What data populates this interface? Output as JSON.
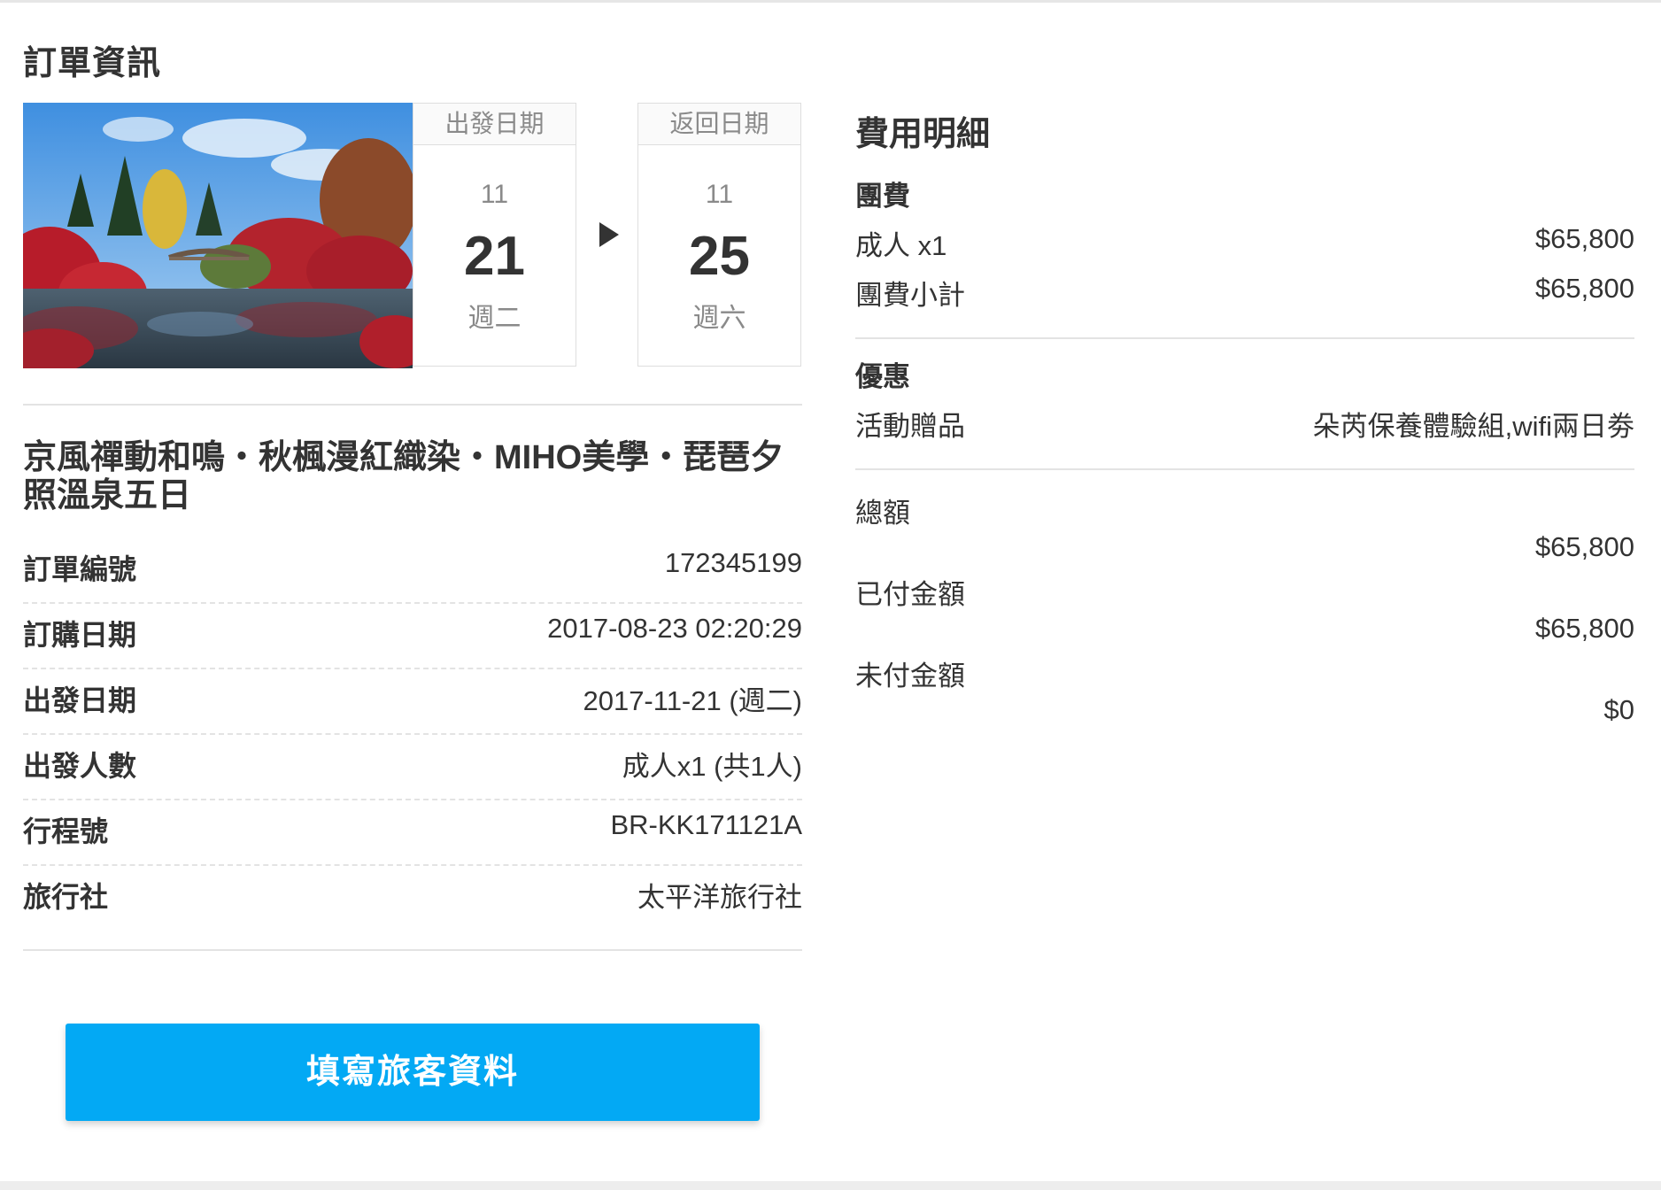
{
  "section_title": "訂單資訊",
  "photo": {
    "alt": "autumn-maple-garden-pond"
  },
  "departure": {
    "header": "出發日期",
    "month": "11",
    "day": "21",
    "weekday": "週二"
  },
  "return": {
    "header": "返回日期",
    "month": "11",
    "day": "25",
    "weekday": "週六"
  },
  "trip_title": "京風禪動和鳴・秋楓漫紅織染・MIHO美學・琵琶夕照溫泉五日",
  "order_info": [
    {
      "label": "訂單編號",
      "value": "172345199"
    },
    {
      "label": "訂購日期",
      "value": "2017-08-23 02:20:29"
    },
    {
      "label": "出發日期",
      "value": "2017-11-21 (週二)"
    },
    {
      "label": "出發人數",
      "value": "成人x1 (共1人)"
    },
    {
      "label": "行程號",
      "value": "BR-KK171121A"
    },
    {
      "label": "旅行社",
      "value": "太平洋旅行社"
    }
  ],
  "cta_label": "填寫旅客資料",
  "fees": {
    "title": "費用明細",
    "group_fee": {
      "heading": "團費",
      "adult": {
        "label": "成人 x1",
        "amount": "$65,800"
      },
      "subtotal": {
        "label": "團費小計",
        "amount": "$65,800"
      }
    },
    "discount": {
      "heading": "優惠",
      "gift": {
        "label": "活動贈品",
        "value": "朵芮保養體驗組,wifi兩日劵"
      }
    },
    "total": {
      "label": "總額",
      "amount": "$65,800"
    },
    "paid": {
      "label": "已付金額",
      "amount": "$65,800"
    },
    "unpaid": {
      "label": "未付金額",
      "amount": "$0"
    }
  },
  "colors": {
    "accent": "#03a9f4",
    "text": "#333333",
    "muted": "#8a8a8a",
    "divider": "#e3e3e3"
  }
}
